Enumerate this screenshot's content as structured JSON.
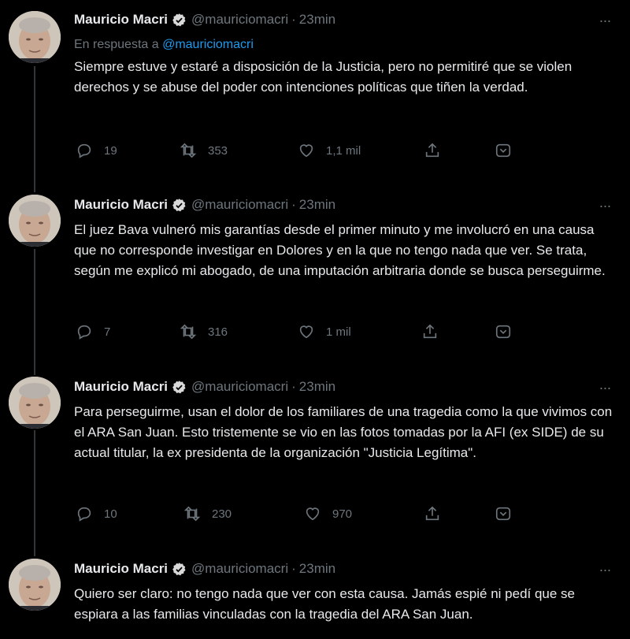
{
  "author": {
    "name": "Mauricio Macri",
    "handle": "@mauriciomacri",
    "separator": "·",
    "verified": true
  },
  "more_label": "···",
  "reply_to": {
    "prefix": "En respuesta a",
    "mention": "@mauriciomacri"
  },
  "tweets": [
    {
      "time": "23min",
      "text": "Siempre estuve y estaré a disposición de la Justicia, pero no permitiré que se violen derechos y se abuse del poder con intenciones políticas que tiñen la verdad.",
      "replies": "19",
      "retweets": "353",
      "likes": "1,1 mil"
    },
    {
      "time": "23min",
      "text": "El juez Bava vulneró mis garantías desde el primer minuto y me involucró en una causa que no corresponde investigar en Dolores y en la que no tengo nada que ver. Se trata, según me explicó mi abogado, de una imputación arbitraria donde se busca perseguirme.",
      "replies": "7",
      "retweets": "316",
      "likes": "1 mil"
    },
    {
      "time": "23min",
      "text": "Para perseguirme, usan el dolor de los familiares de una tragedia como la que vivimos con el ARA San Juan. Esto tristemente se vio en las fotos tomadas por la AFI (ex SIDE) de su actual titular, la ex presidenta de la organización \"Justicia Legítima\".",
      "replies": "10",
      "retweets": "230",
      "likes": "970"
    },
    {
      "time": "23min",
      "text": "Quiero ser claro: no tengo nada que ver con esta causa. Jamás espié ni pedí que se espiara a las familias vinculadas con la tragedia del ARA San Juan."
    }
  ],
  "colors": {
    "background": "#000000",
    "text": "#e7e9ea",
    "muted": "#6e767d",
    "link": "#1d9bf0",
    "verified": "#d9d9d9"
  },
  "icons": [
    "reply-icon",
    "retweet-icon",
    "like-icon",
    "share-icon",
    "bookmark-icon",
    "verified-badge-icon",
    "more-icon"
  ]
}
